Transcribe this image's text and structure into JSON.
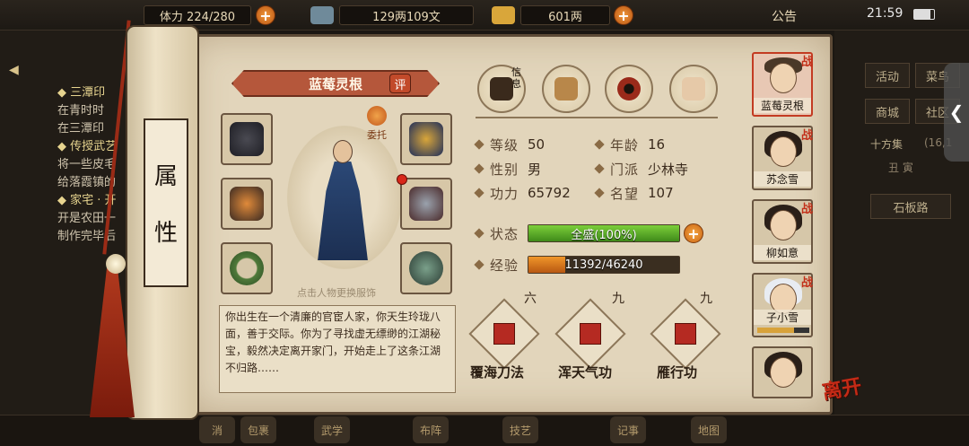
{
  "topbar": {
    "stamina": "体力 224/280",
    "silver": "129两109文",
    "gold": "601两",
    "notice": "公告",
    "clock": "21:59"
  },
  "left_panel": {
    "quests": [
      {
        "title": "◆ 三潭印",
        "lines": [
          "在青时时",
          "在三潭印"
        ]
      },
      {
        "title": "◆ 传授武艺",
        "lines": [
          "将一些皮毛",
          "给落霞镇的"
        ]
      },
      {
        "title": "◆ 家宅 · 开",
        "lines": [
          "开是农田一",
          "制作完毕后"
        ]
      }
    ]
  },
  "scroll": {
    "side_label_top": "属",
    "side_label_bottom": "性"
  },
  "character": {
    "name": "蓝莓灵根",
    "review_badge": "评",
    "entrust_label": "委托",
    "change_outfit_hint": "点击人物更换服饰",
    "bio": "你出生在一个清廉的官宦人家，你天生玲珑八面，善于交际。你为了寻找虚无缥缈的江湖秘宝，毅然决定离开家门，开始走上了这条江湖不归路……"
  },
  "tabs": [
    {
      "name": "info",
      "label": "信息",
      "color": "#c8a060"
    },
    {
      "name": "inventory",
      "label": "",
      "color": "#b8874a"
    },
    {
      "name": "bagua",
      "label": "",
      "color": "#9a2a1a"
    },
    {
      "name": "meridian",
      "label": "",
      "color": "#e6c9a8"
    }
  ],
  "stats": {
    "level_label": "等级",
    "level": "50",
    "age_label": "年龄",
    "age": "16",
    "gender_label": "性别",
    "gender": "男",
    "sect_label": "门派",
    "sect": "少林寺",
    "power_label": "功力",
    "power": "65792",
    "fame_label": "名望",
    "fame": "107",
    "state_label": "状态",
    "state": "全盛(100%)",
    "state_pct": 100,
    "exp_label": "经验",
    "exp": "11392/46240",
    "exp_pct": 24.6
  },
  "skills": [
    {
      "name": "覆海刀法",
      "level": "六"
    },
    {
      "name": "浑天气功",
      "level": "九"
    },
    {
      "name": "雁行功",
      "level": "九"
    }
  ],
  "party": [
    {
      "name": "蓝莓灵根",
      "badge": "战",
      "selected": true
    },
    {
      "name": "苏念雪",
      "badge": "战",
      "selected": false
    },
    {
      "name": "柳如意",
      "badge": "战",
      "selected": false
    },
    {
      "name": "子小雪",
      "badge": "战",
      "selected": false
    },
    {
      "name": "",
      "badge": "",
      "selected": false
    }
  ],
  "leave_label": "离开",
  "right_panel": {
    "buttons": [
      "活动",
      "菜鸟",
      "商城",
      "社区"
    ],
    "area": "十方集",
    "area_code": "(16,1",
    "time": "丑 寅",
    "road": "石板路"
  },
  "bottom_icons": [
    "消",
    "包裹",
    "武学",
    "布阵",
    "技艺",
    "记事",
    "地图"
  ]
}
